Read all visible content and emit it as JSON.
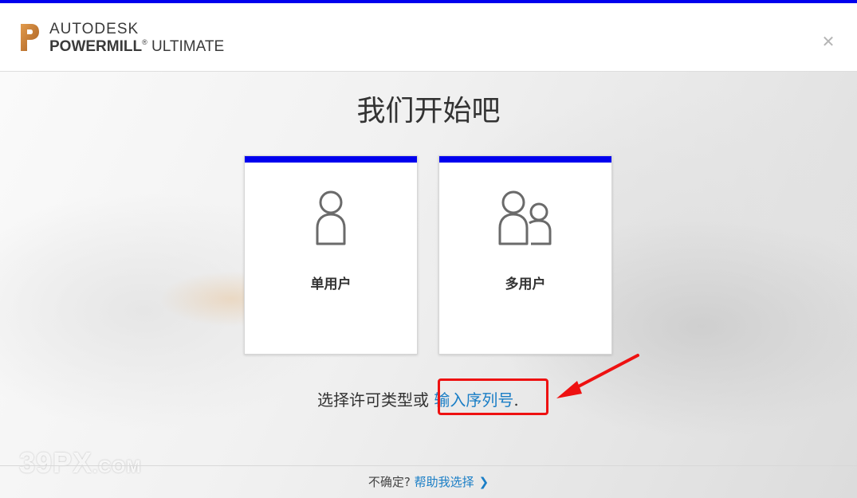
{
  "header": {
    "brand_top": "AUTODESK",
    "brand_product_bold": "POWERMILL",
    "brand_product_rest": "ULTIMATE",
    "logo_icon": "autodesk-p-logo",
    "close_icon": "close-icon",
    "close_glyph": "✕"
  },
  "main": {
    "title": "我们开始吧",
    "cards": [
      {
        "label": "单用户",
        "icon": "single-user-icon"
      },
      {
        "label": "多用户",
        "icon": "multi-user-icon"
      }
    ],
    "choose_prefix": "选择许可类型或",
    "serial_link": "输入序列号",
    "choose_suffix": "."
  },
  "footer": {
    "question": "不确定?",
    "help_link": "帮助我选择",
    "chevron": "❯"
  },
  "watermark": {
    "main": "39PX",
    "suffix": ".COM"
  },
  "colors": {
    "accent_bar": "#0000ee",
    "link": "#1a7ec6",
    "annotation": "#ee1111"
  }
}
